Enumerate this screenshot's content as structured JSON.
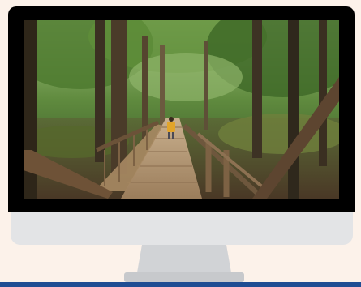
{
  "image": {
    "subject": "forest-boardwalk-hiker"
  },
  "colors": {
    "background": "#fcf2ea",
    "bezel": "#000000",
    "chin": "#e3e4e6",
    "stand": "#d1d3d6",
    "accent_bar": "#1f4d93"
  }
}
